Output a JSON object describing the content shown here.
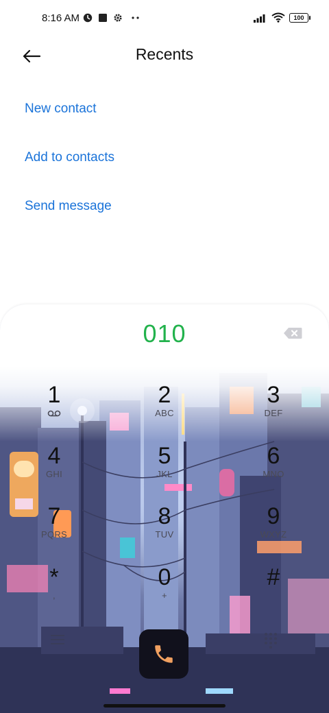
{
  "status_bar": {
    "time": "8:16 AM",
    "battery": "100",
    "icons": [
      "vpn-icon",
      "square-notification-icon",
      "gear-icon",
      "more-dots-icon",
      "signal-icon",
      "wifi-icon",
      "battery-icon"
    ]
  },
  "header": {
    "title": "Recents",
    "back_icon": "back-arrow-icon"
  },
  "actions": {
    "new_contact": "New contact",
    "add_to_contacts": "Add to contacts",
    "send_message": "Send message"
  },
  "dialer": {
    "number": "010",
    "keys": [
      {
        "digit": "1",
        "letters": ""
      },
      {
        "digit": "2",
        "letters": "ABC"
      },
      {
        "digit": "3",
        "letters": "DEF"
      },
      {
        "digit": "4",
        "letters": "GHI"
      },
      {
        "digit": "5",
        "letters": "JKL"
      },
      {
        "digit": "6",
        "letters": "MNO"
      },
      {
        "digit": "7",
        "letters": "PQRS"
      },
      {
        "digit": "8",
        "letters": "TUV"
      },
      {
        "digit": "9",
        "letters": "WXYZ"
      },
      {
        "digit": "*",
        "letters": ","
      },
      {
        "digit": "0",
        "letters": "+"
      },
      {
        "digit": "#",
        "letters": ""
      }
    ],
    "colors": {
      "number": "#22b24c",
      "link": "#1a73d9",
      "call_button": "#11111c",
      "call_icon": "#f0a060"
    }
  }
}
